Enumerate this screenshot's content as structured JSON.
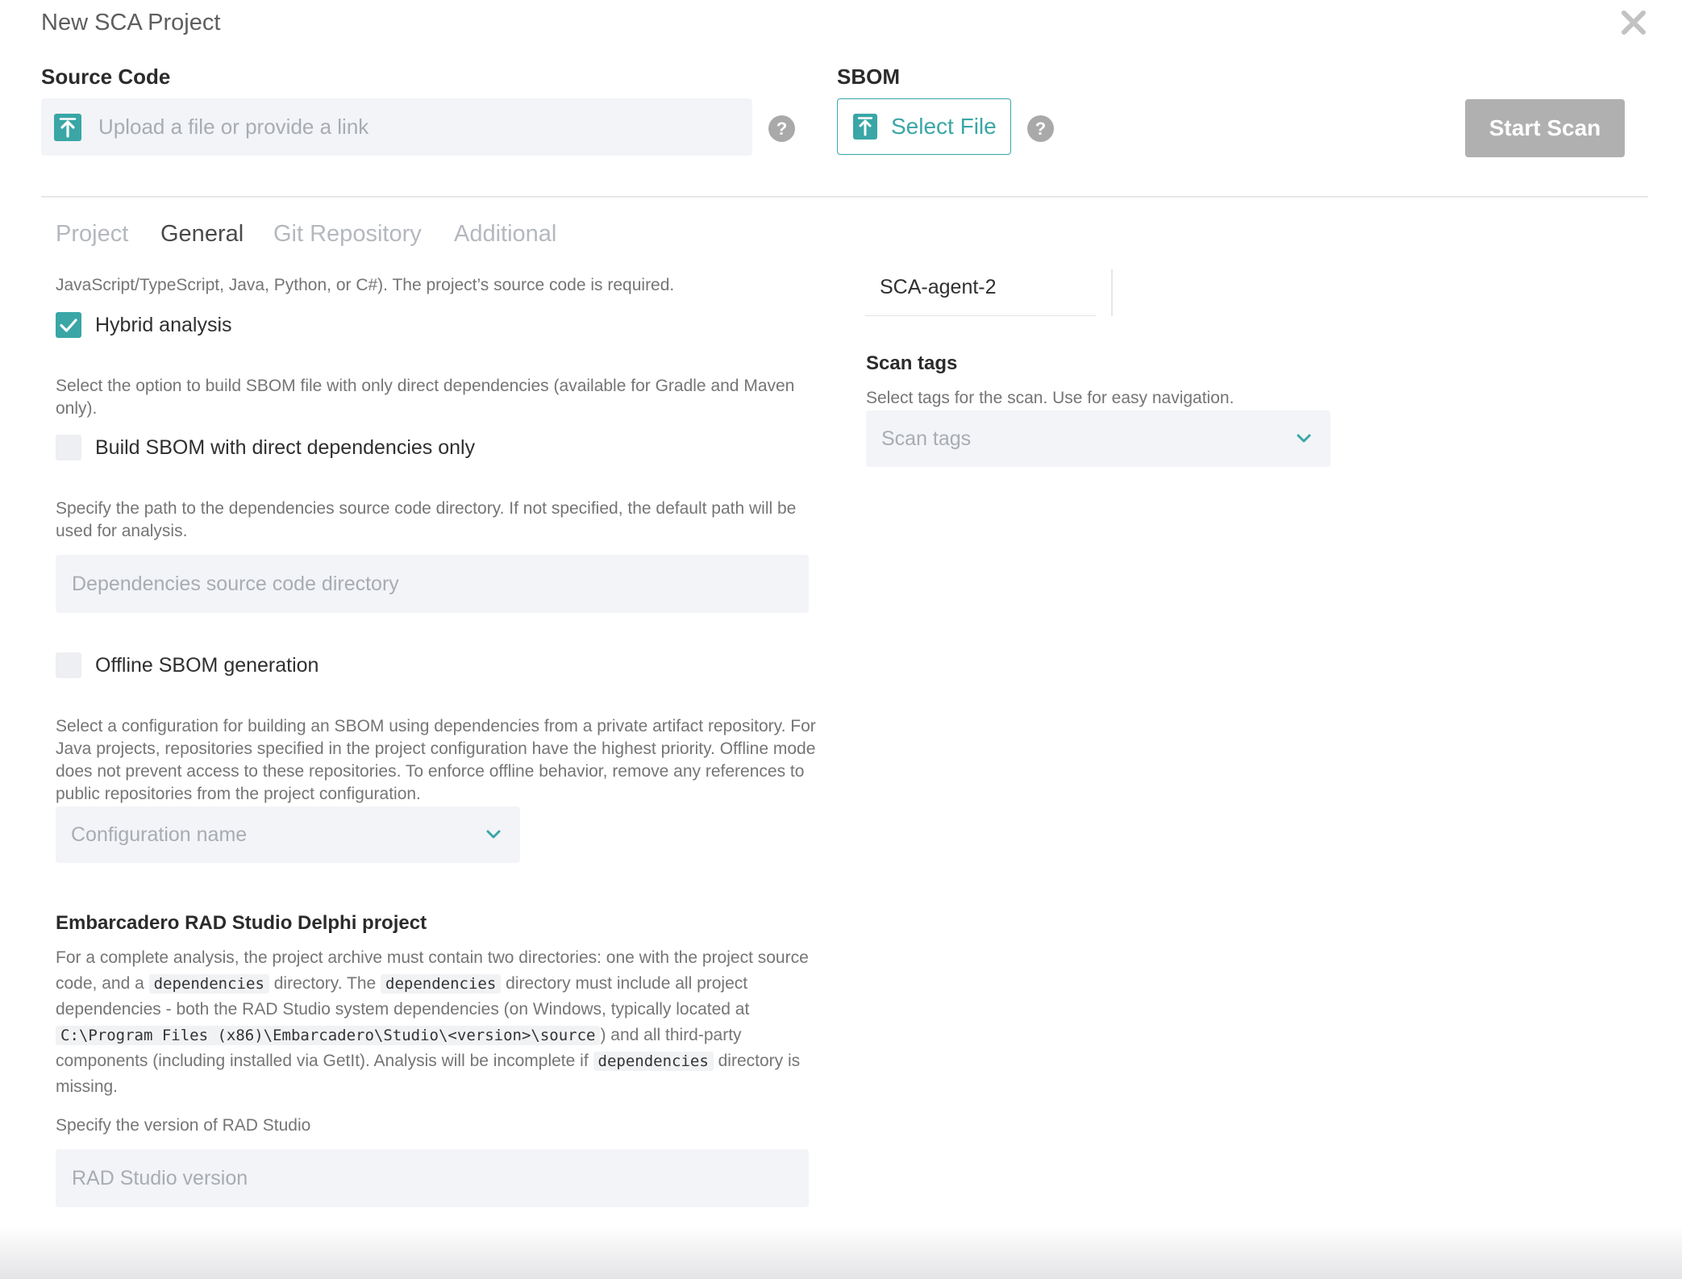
{
  "dialog": {
    "title": "New SCA Project",
    "close_icon": "close-icon"
  },
  "source_code": {
    "label": "Source Code",
    "placeholder": "Upload a file or provide a link",
    "help": "?"
  },
  "sbom": {
    "label": "SBOM",
    "select_file_label": "Select File",
    "help": "?"
  },
  "start_scan_label": "Start Scan",
  "tabs": [
    {
      "label": "Project",
      "active": false
    },
    {
      "label": "General",
      "active": true
    },
    {
      "label": "Git Repository",
      "active": false
    },
    {
      "label": "Additional",
      "active": false
    }
  ],
  "general": {
    "hybrid_desc_tail": "JavaScript/TypeScript, Java, Python, or C#). The project’s source code is required.",
    "hybrid_label": "Hybrid analysis",
    "hybrid_checked": true,
    "direct_desc": "Select the option to build SBOM file with only direct dependencies (available for Gradle and Maven only).",
    "direct_label": "Build SBOM with direct dependencies only",
    "direct_checked": false,
    "deps_desc": "Specify the path to the dependencies source code directory. If not specified, the default path will be used for analysis.",
    "deps_placeholder": "Dependencies source code directory",
    "offline_label": "Offline SBOM generation",
    "offline_checked": false,
    "config_desc": "Select a configuration for building an SBOM using dependencies from a private artifact repository. For Java projects, repositories specified in the project configuration have the highest priority. Offline mode does not prevent access to these repositories. To enforce offline behavior, remove any references to public repositories from the project configuration.",
    "config_placeholder": "Configuration name",
    "delphi_heading": "Embarcadero RAD Studio Delphi project",
    "delphi_p1": "For a complete analysis, the project archive must contain two directories: one with the project source code, and a",
    "delphi_code1": "dependencies",
    "delphi_p2": "directory. The",
    "delphi_code2": "dependencies",
    "delphi_p3": "directory must include all project dependencies - both the RAD Studio system dependencies (on Windows, typically located at",
    "delphi_code3": "C:\\Program Files (x86)\\Embarcadero\\Studio\\<version>\\source",
    "delphi_p4": ") and all third-party components (including installed via GetIt). Analysis will be incomplete if",
    "delphi_code4": "dependencies",
    "delphi_p5": "directory is missing.",
    "rad_desc": "Specify the version of RAD Studio",
    "rad_placeholder": "RAD Studio version"
  },
  "right": {
    "agent_value": "SCA-agent-2",
    "scan_tags_label": "Scan tags",
    "scan_tags_desc": "Select tags for the scan. Use for easy navigation.",
    "scan_tags_placeholder": "Scan tags"
  },
  "colors": {
    "accent": "#3aa6a6",
    "disabled_button": "#b0b0b0",
    "field_bg": "#f3f4f7"
  }
}
